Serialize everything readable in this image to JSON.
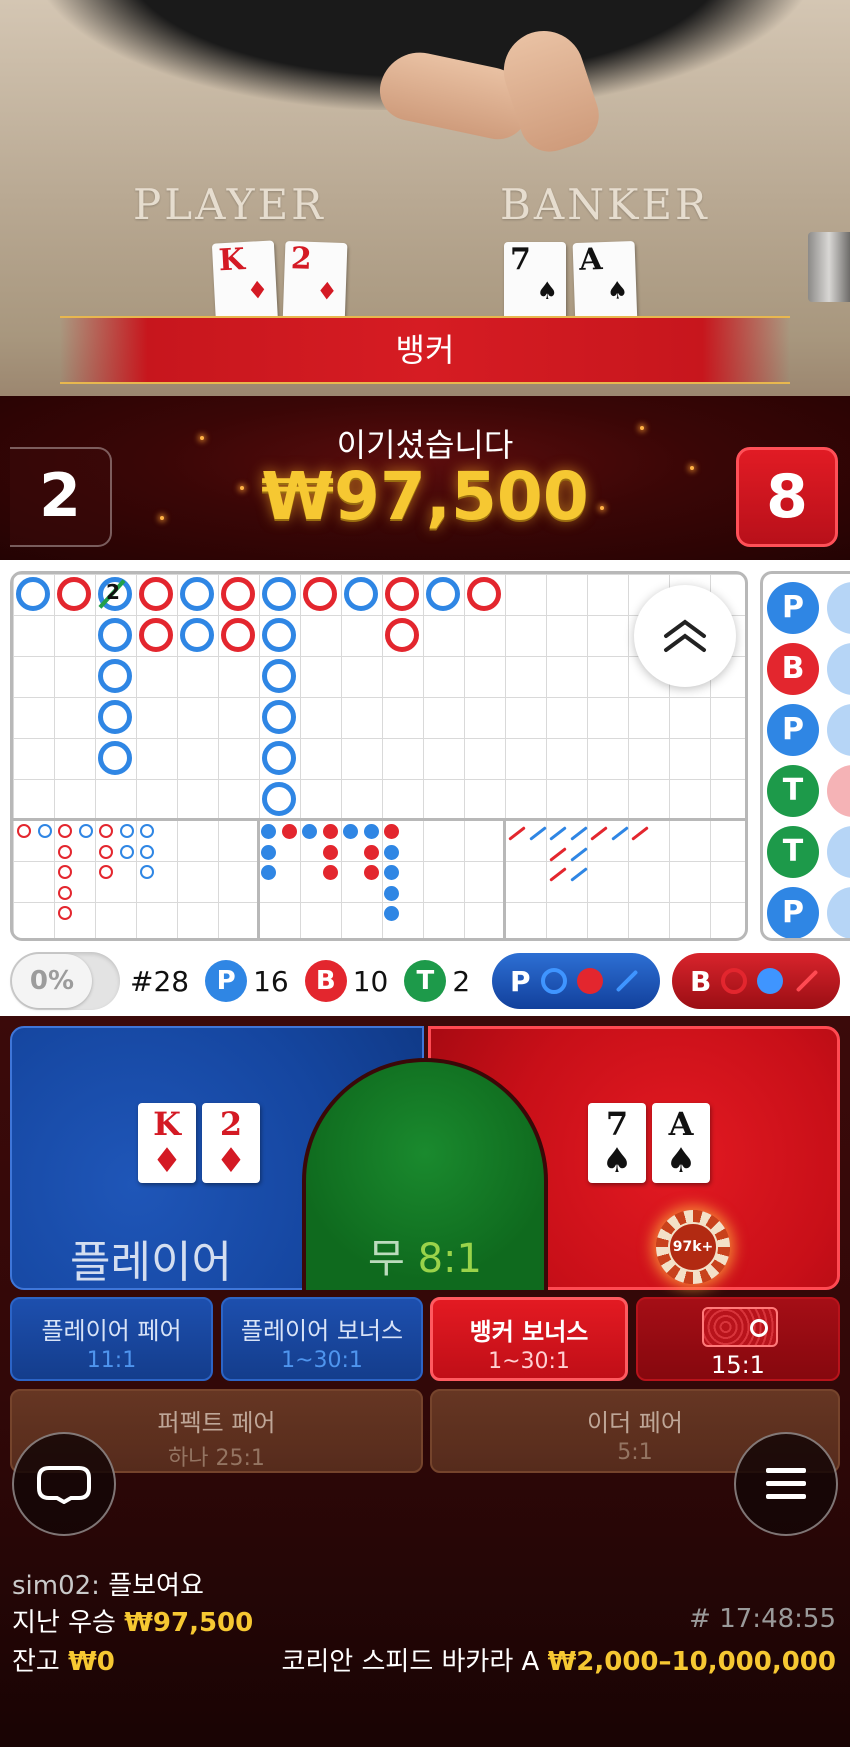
{
  "table": {
    "player_label": "PLAYER",
    "banker_label": "BANKER",
    "player_cards": [
      {
        "rank": "K",
        "suit": "♦",
        "color": "#d41a24"
      },
      {
        "rank": "2",
        "suit": "♦",
        "color": "#d41a24"
      }
    ],
    "banker_cards": [
      {
        "rank": "7",
        "suit": "♠",
        "color": "#111111"
      },
      {
        "rank": "A",
        "suit": "♠",
        "color": "#111111"
      }
    ]
  },
  "result": {
    "winner": "뱅커",
    "caption": "이기셨습니다",
    "amount": "₩97,500",
    "player_score": "2",
    "banker_score": "8"
  },
  "roadmap": {
    "tie_count": "2",
    "collapse_icon": "chevron-double-up-icon",
    "side_beads": [
      {
        "label": "P",
        "type": "p"
      },
      {
        "label": "B",
        "type": "b"
      },
      {
        "label": "P",
        "type": "p"
      },
      {
        "label": "T",
        "type": "t"
      },
      {
        "label": "T",
        "type": "t"
      },
      {
        "label": "P",
        "type": "p"
      }
    ]
  },
  "stats": {
    "percent_toggle": "0%",
    "round": "#28",
    "player": {
      "label": "P",
      "count": "16"
    },
    "banker": {
      "label": "B",
      "count": "10"
    },
    "tie": {
      "label": "T",
      "count": "2"
    }
  },
  "predict": {
    "player_label": "P",
    "banker_label": "B"
  },
  "bets": {
    "player": {
      "label": "플레이어",
      "cards": [
        {
          "rank": "K",
          "suit": "♦"
        },
        {
          "rank": "2",
          "suit": "♦"
        }
      ]
    },
    "tie": {
      "label": "무",
      "odds": "8:1"
    },
    "banker": {
      "cards": [
        {
          "rank": "7",
          "suit": "♠"
        },
        {
          "rank": "A",
          "suit": "♠"
        }
      ],
      "chip": "97k+"
    },
    "player_pair": {
      "label": "플레이어 페어",
      "odds": "11:1"
    },
    "player_bonus": {
      "label": "플레이어 보너스",
      "odds": "1~30:1"
    },
    "banker_bonus": {
      "label": "뱅커 보너스",
      "odds": "1~30:1"
    },
    "dragon": {
      "odds": "15:1",
      "icon": "dragon-bonus-icon"
    },
    "perfect_pair": {
      "label": "퍼펙트 페어",
      "odds": "하나 25:1"
    },
    "either_pair": {
      "label": "이더 페어",
      "odds": "5:1"
    }
  },
  "controls": {
    "chat_icon": "chat-bubble-icon",
    "menu_icon": "hamburger-menu-icon"
  },
  "footer": {
    "chat_user": "sim02:",
    "chat_message": "플보여요",
    "last_win_label": "지난 우승",
    "last_win_amount": "₩97,500",
    "round_id": "# 17:48:55",
    "balance_label": "잔고",
    "balance_amount": "₩0",
    "table_name": "코리안 스피드 바카라 A",
    "limits": "₩2,000–10,000,000"
  },
  "colors": {
    "player_blue": "#2f86e4",
    "banker_red": "#e3262e",
    "tie_green": "#1d9a4a",
    "gold": "#f6c832"
  }
}
